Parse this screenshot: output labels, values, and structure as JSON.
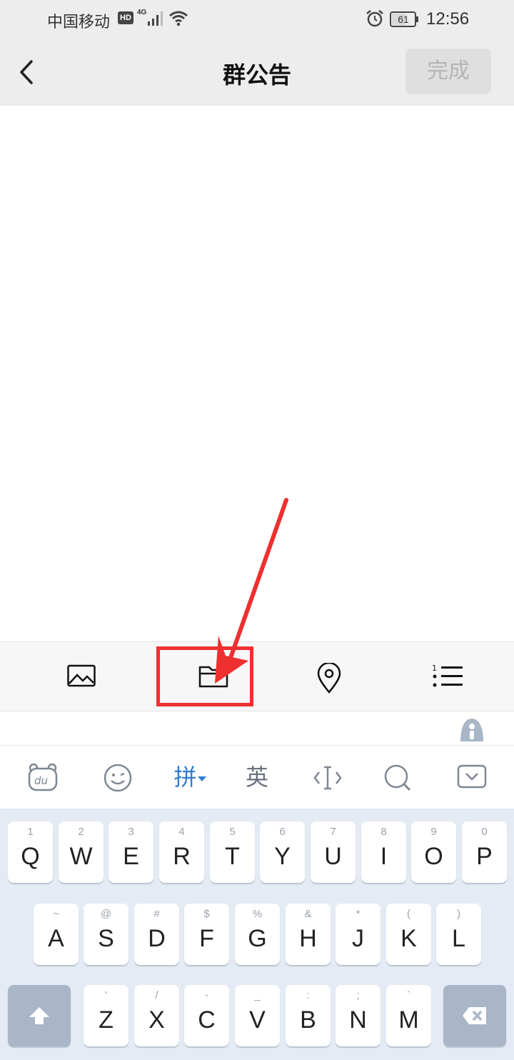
{
  "status_bar": {
    "carrier": "中国移动",
    "hd": "HD",
    "network": "4G",
    "battery": "61",
    "time": "12:56"
  },
  "nav": {
    "title": "群公告",
    "done_label": "完成"
  },
  "toolbar": {
    "items": [
      "image-icon",
      "folder-icon",
      "location-icon",
      "list-icon"
    ],
    "highlighted": "folder-icon",
    "annotation_color": "#ee3030"
  },
  "keyboard": {
    "top_bar": {
      "pinyin_label": "拼",
      "english_label": "英",
      "icons": [
        "du-bear-icon",
        "emoji-icon",
        "cursor-icon",
        "search-icon",
        "hide-keyboard-icon"
      ]
    },
    "row1": [
      {
        "main": "Q",
        "sub": "1"
      },
      {
        "main": "W",
        "sub": "2"
      },
      {
        "main": "E",
        "sub": "3"
      },
      {
        "main": "R",
        "sub": "4"
      },
      {
        "main": "T",
        "sub": "5"
      },
      {
        "main": "Y",
        "sub": "6"
      },
      {
        "main": "U",
        "sub": "7"
      },
      {
        "main": "I",
        "sub": "8"
      },
      {
        "main": "O",
        "sub": "9"
      },
      {
        "main": "P",
        "sub": "0"
      }
    ],
    "row2": [
      {
        "main": "A",
        "sub": "~"
      },
      {
        "main": "S",
        "sub": "@"
      },
      {
        "main": "D",
        "sub": "#"
      },
      {
        "main": "F",
        "sub": "$"
      },
      {
        "main": "G",
        "sub": "%"
      },
      {
        "main": "H",
        "sub": "&"
      },
      {
        "main": "J",
        "sub": "*"
      },
      {
        "main": "K",
        "sub": "("
      },
      {
        "main": "L",
        "sub": ")"
      }
    ],
    "row3": [
      {
        "main": "Z",
        "sub": "'"
      },
      {
        "main": "X",
        "sub": "/"
      },
      {
        "main": "C",
        "sub": "-"
      },
      {
        "main": "V",
        "sub": "_"
      },
      {
        "main": "B",
        "sub": ":"
      },
      {
        "main": "N",
        "sub": ";"
      },
      {
        "main": "M",
        "sub": "`"
      }
    ],
    "accent_color": "#2f7dd6"
  }
}
